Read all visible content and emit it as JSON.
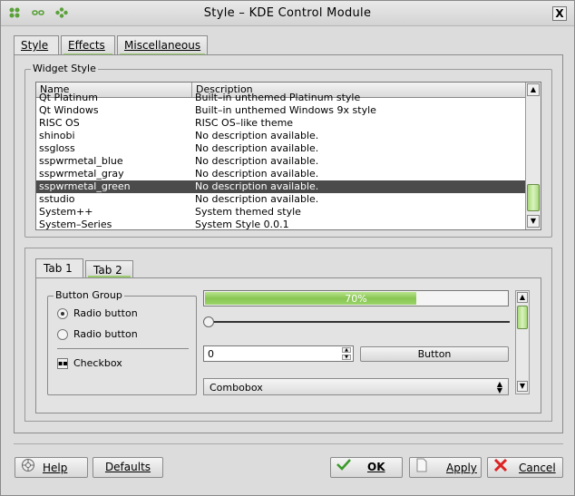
{
  "window": {
    "title": "Style – KDE Control Module",
    "close": "X"
  },
  "tabs": [
    {
      "label": "Style"
    },
    {
      "label": "Effects"
    },
    {
      "label": "Miscellaneous"
    }
  ],
  "widget_style": {
    "group_title": "Widget Style",
    "columns": [
      "Name",
      "Description"
    ],
    "rows": [
      {
        "name": "Qt Platinum",
        "desc": "Built–in unthemed Platinum style"
      },
      {
        "name": "Qt Windows",
        "desc": "Built–in unthemed Windows 9x style"
      },
      {
        "name": "RISC OS",
        "desc": "RISC OS–like theme"
      },
      {
        "name": "shinobi",
        "desc": "No description available."
      },
      {
        "name": "ssgloss",
        "desc": "No description available."
      },
      {
        "name": "sspwrmetal_blue",
        "desc": "No description available."
      },
      {
        "name": "sspwrmetal_gray",
        "desc": "No description available."
      },
      {
        "name": "sspwrmetal_green",
        "desc": "No description available."
      },
      {
        "name": "sstudio",
        "desc": "No description available."
      },
      {
        "name": "System++",
        "desc": "System themed style"
      },
      {
        "name": "System–Series",
        "desc": "System Style 0.0.1"
      }
    ]
  },
  "preview": {
    "tabs": [
      {
        "label": "Tab 1"
      },
      {
        "label": "Tab 2"
      }
    ],
    "button_group": {
      "title": "Button Group",
      "radio1": "Radio button",
      "radio2": "Radio button",
      "checkbox": "Checkbox"
    },
    "progress": {
      "value": 0.7,
      "text": "70%"
    },
    "spin_value": "0",
    "button_label": "Button",
    "combo_label": "Combobox"
  },
  "footer": {
    "help": "Help",
    "defaults": "Defaults",
    "ok": "OK",
    "apply": "Apply",
    "cancel": "Cancel"
  },
  "colors": {
    "accent_green": "#88c653",
    "selection": "#4b4b4b",
    "cancel_red": "#d22"
  }
}
